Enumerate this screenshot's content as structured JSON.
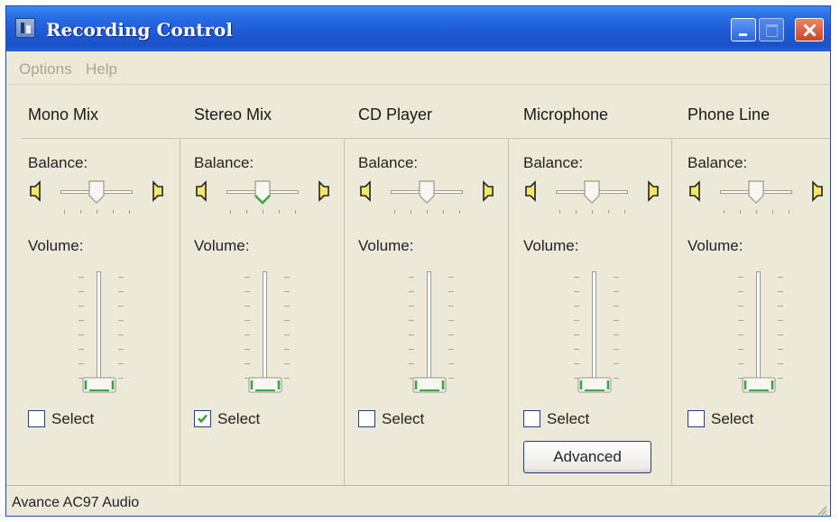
{
  "window": {
    "title": "Recording Control"
  },
  "menu": {
    "items": [
      "Options",
      "Help"
    ]
  },
  "channels": [
    {
      "name": "Mono Mix",
      "balance_label": "Balance:",
      "balance": 0.5,
      "volume_label": "Volume:",
      "volume": 0.0,
      "select_label": "Select",
      "selected": false
    },
    {
      "name": "Stereo Mix",
      "balance_label": "Balance:",
      "balance": 0.5,
      "volume_label": "Volume:",
      "volume": 0.0,
      "select_label": "Select",
      "selected": true
    },
    {
      "name": "CD Player",
      "balance_label": "Balance:",
      "balance": 0.5,
      "volume_label": "Volume:",
      "volume": 0.0,
      "select_label": "Select",
      "selected": false
    },
    {
      "name": "Microphone",
      "balance_label": "Balance:",
      "balance": 0.5,
      "volume_label": "Volume:",
      "volume": 0.0,
      "select_label": "Select",
      "selected": false,
      "advanced_label": "Advanced"
    },
    {
      "name": "Phone Line",
      "balance_label": "Balance:",
      "balance": 0.5,
      "volume_label": "Volume:",
      "volume": 0.0,
      "select_label": "Select",
      "selected": false
    }
  ],
  "status": {
    "text": "Avance AC97 Audio"
  },
  "colors": {
    "titlebar": "#2a6fe6",
    "face": "#ece9d8",
    "slider_accent": "#3aa640",
    "close": "#c9472a"
  },
  "icons": [
    "app-icon",
    "minimize-icon",
    "maximize-icon",
    "close-icon",
    "speaker-left-icon",
    "speaker-right-icon",
    "checkmark-icon",
    "resize-grip-icon"
  ]
}
